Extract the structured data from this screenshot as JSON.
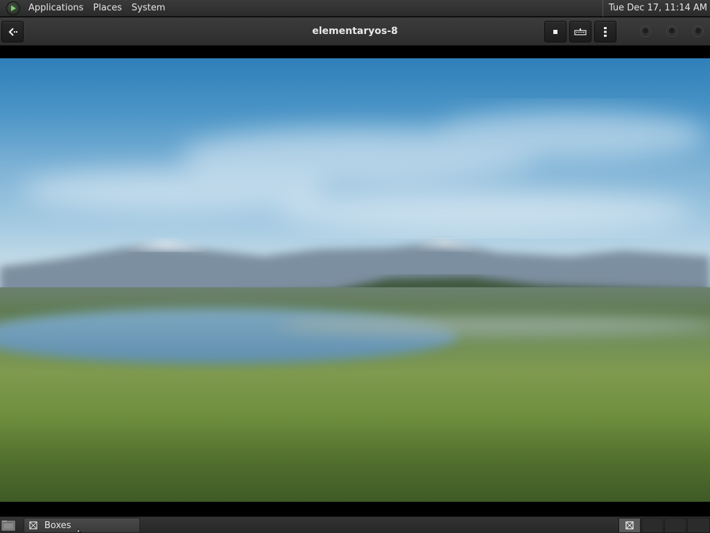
{
  "top_panel": {
    "menus": [
      "Applications",
      "Places",
      "System"
    ],
    "clock": "Tue Dec 17, 11:14 AM"
  },
  "header_bar": {
    "title": "elementaryos-8",
    "back_icon": "back-arrow-icon",
    "buttons": [
      "stop-icon",
      "keyboard-icon",
      "kebab-menu-icon"
    ]
  },
  "vm_display": {
    "content": "elementaryos-desktop-wallpaper"
  },
  "taskbar": {
    "task_label": "Boxes",
    "workspace_count": 4,
    "active_workspace": 1
  },
  "colors": {
    "panel": "#2b2b2b",
    "text": "#e6e6e6",
    "sky": "#4a94c6",
    "grass": "#6f8c5a"
  }
}
